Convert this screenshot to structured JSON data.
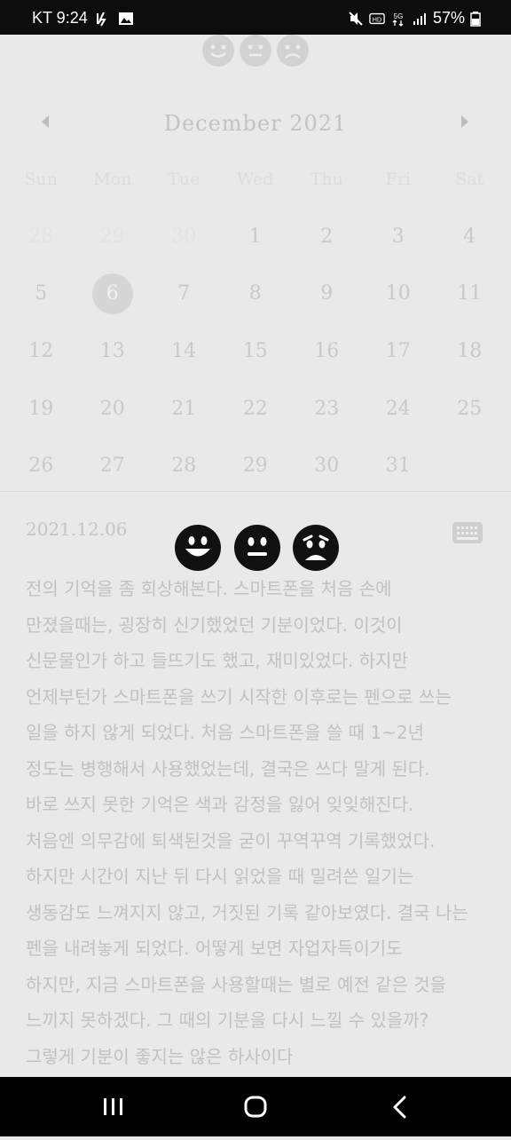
{
  "status_bar": {
    "carrier_time": "KT 9:24",
    "battery": "57%"
  },
  "calendar": {
    "month_title": "December 2021",
    "weekdays": [
      "Sun",
      "Mon",
      "Tue",
      "Wed",
      "Thu",
      "Fri",
      "Sat"
    ],
    "weeks": [
      [
        "28",
        "29",
        "30",
        "1",
        "2",
        "3",
        "4"
      ],
      [
        "5",
        "6",
        "7",
        "8",
        "9",
        "10",
        "11"
      ],
      [
        "12",
        "13",
        "14",
        "15",
        "16",
        "17",
        "18"
      ],
      [
        "19",
        "20",
        "21",
        "22",
        "23",
        "24",
        "25"
      ],
      [
        "26",
        "27",
        "28",
        "29",
        "30",
        "31",
        ""
      ]
    ],
    "selected_day": "6"
  },
  "entry": {
    "date": "2021.12.06",
    "text": "전의 기억을 좀 회상해본다. 스마트폰을 처음 손에\n만졌을때는, 굉장히 신기했었던 기분이었다. 이것이\n신문물인가 하고 들뜨기도 했고, 재미있었다. 하지만\n언제부턴가 스마트폰을 쓰기 시작한 이후로는 펜으로 쓰는\n일을 하지 않게 되었다. 처음 스마트폰을 쓸 때 1~2년\n정도는 병행해서 사용했었는데, 결국은 쓰다 말게 된다.\n바로 쓰지 못한 기억은 색과 감정을 잃어 잊잊해진다.\n처음엔 의무감에 퇴색된것을 굳이 꾸역꾸역 기록했었다.\n하지만 시간이 지난 뒤 다시 읽었을 때 밀려쓴 일기는\n생동감도 느껴지지 않고, 거짓된 기록 같아보였다. 결국 나는\n펜을 내려놓게 되었다. 어떻게 보면 자업자득이기도\n하지만, 지금 스마트폰을 사용할때는 별로 예전 같은 것을\n느끼지 못하겠다. 그 때의 기분을 다시 느낄 수 있을까?\n그렇게 기분이 좋지는 않은 하사이다"
  },
  "icons": {
    "mood_faces": [
      "happy-face-icon",
      "neutral-face-icon",
      "sad-face-icon"
    ]
  }
}
